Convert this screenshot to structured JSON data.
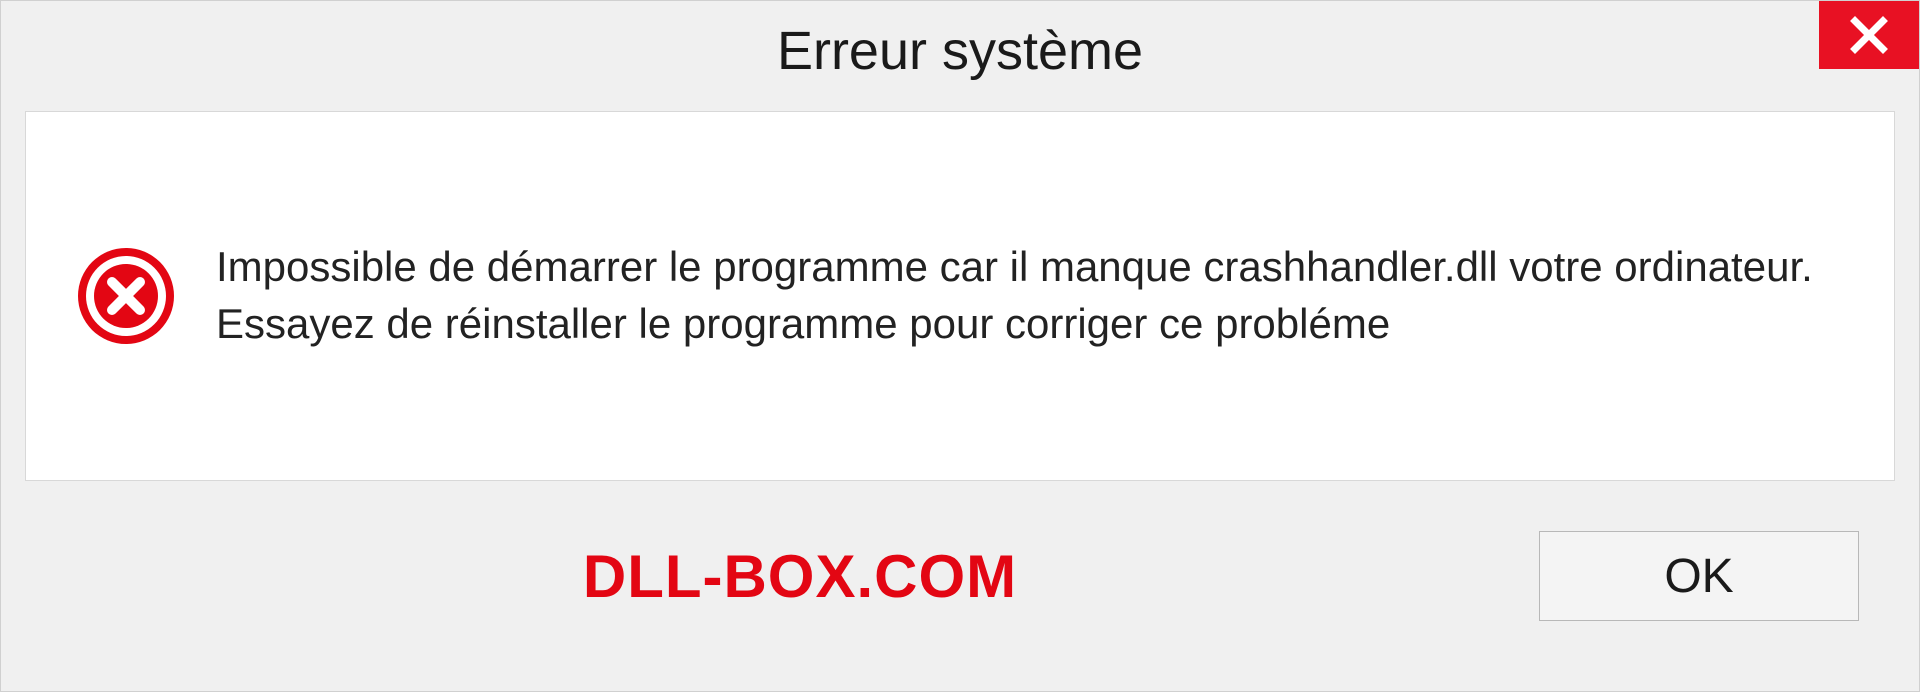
{
  "dialog": {
    "title": "Erreur système",
    "message": "Impossible de démarrer le programme car il manque crashhandler.dll votre ordinateur. Essayez de réinstaller le programme pour corriger ce probléme",
    "branding": "DLL-BOX.COM",
    "ok_label": "OK"
  }
}
